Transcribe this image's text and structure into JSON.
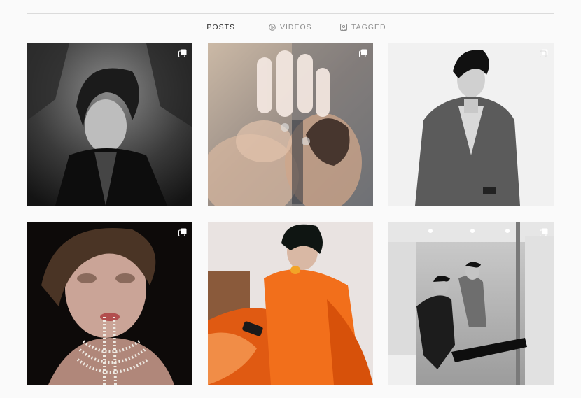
{
  "tabs": [
    {
      "label": "POSTS",
      "icon": "grid-icon",
      "active": true
    },
    {
      "label": "VIDEOS",
      "icon": "play-icon",
      "active": false
    },
    {
      "label": "TAGGED",
      "icon": "tag-icon",
      "active": false
    }
  ],
  "posts": [
    {
      "description_icon": "carousel-icon",
      "multi": true,
      "tone": "bw-outdoor-portrait"
    },
    {
      "description_icon": "carousel-icon",
      "multi": true,
      "tone": "glass-reflection"
    },
    {
      "description_icon": "carousel-icon",
      "multi": true,
      "tone": "bw-suit-studio"
    },
    {
      "description_icon": "carousel-icon",
      "multi": true,
      "tone": "pearls-closeup"
    },
    {
      "description_icon": "",
      "multi": false,
      "tone": "orange-velvet"
    },
    {
      "description_icon": "carousel-icon",
      "multi": true,
      "tone": "bw-bathroom-mirror"
    }
  ],
  "colors": {
    "background": "#fafafa",
    "divider": "#dbdbdb",
    "active_tab": "#262626",
    "inactive_tab": "#8e8e8e"
  }
}
